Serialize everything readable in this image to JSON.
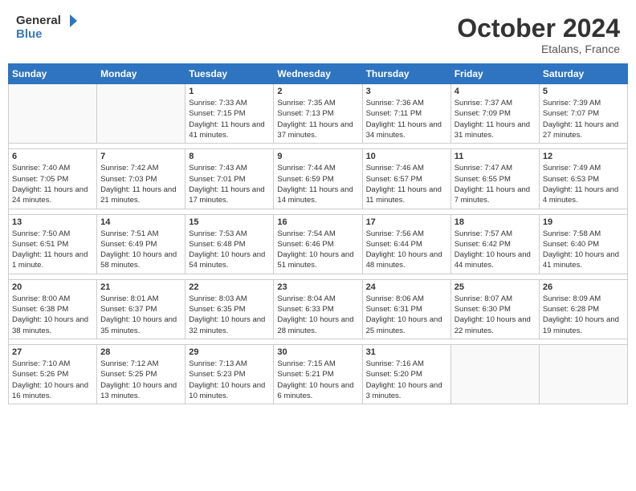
{
  "header": {
    "logo_general": "General",
    "logo_blue": "Blue",
    "month_title": "October 2024",
    "location": "Etalans, France"
  },
  "calendar": {
    "headers": [
      "Sunday",
      "Monday",
      "Tuesday",
      "Wednesday",
      "Thursday",
      "Friday",
      "Saturday"
    ],
    "weeks": [
      {
        "days": [
          {
            "number": "",
            "info": ""
          },
          {
            "number": "",
            "info": ""
          },
          {
            "number": "1",
            "info": "Sunrise: 7:33 AM\nSunset: 7:15 PM\nDaylight: 11 hours and 41 minutes."
          },
          {
            "number": "2",
            "info": "Sunrise: 7:35 AM\nSunset: 7:13 PM\nDaylight: 11 hours and 37 minutes."
          },
          {
            "number": "3",
            "info": "Sunrise: 7:36 AM\nSunset: 7:11 PM\nDaylight: 11 hours and 34 minutes."
          },
          {
            "number": "4",
            "info": "Sunrise: 7:37 AM\nSunset: 7:09 PM\nDaylight: 11 hours and 31 minutes."
          },
          {
            "number": "5",
            "info": "Sunrise: 7:39 AM\nSunset: 7:07 PM\nDaylight: 11 hours and 27 minutes."
          }
        ]
      },
      {
        "days": [
          {
            "number": "6",
            "info": "Sunrise: 7:40 AM\nSunset: 7:05 PM\nDaylight: 11 hours and 24 minutes."
          },
          {
            "number": "7",
            "info": "Sunrise: 7:42 AM\nSunset: 7:03 PM\nDaylight: 11 hours and 21 minutes."
          },
          {
            "number": "8",
            "info": "Sunrise: 7:43 AM\nSunset: 7:01 PM\nDaylight: 11 hours and 17 minutes."
          },
          {
            "number": "9",
            "info": "Sunrise: 7:44 AM\nSunset: 6:59 PM\nDaylight: 11 hours and 14 minutes."
          },
          {
            "number": "10",
            "info": "Sunrise: 7:46 AM\nSunset: 6:57 PM\nDaylight: 11 hours and 11 minutes."
          },
          {
            "number": "11",
            "info": "Sunrise: 7:47 AM\nSunset: 6:55 PM\nDaylight: 11 hours and 7 minutes."
          },
          {
            "number": "12",
            "info": "Sunrise: 7:49 AM\nSunset: 6:53 PM\nDaylight: 11 hours and 4 minutes."
          }
        ]
      },
      {
        "days": [
          {
            "number": "13",
            "info": "Sunrise: 7:50 AM\nSunset: 6:51 PM\nDaylight: 11 hours and 1 minute."
          },
          {
            "number": "14",
            "info": "Sunrise: 7:51 AM\nSunset: 6:49 PM\nDaylight: 10 hours and 58 minutes."
          },
          {
            "number": "15",
            "info": "Sunrise: 7:53 AM\nSunset: 6:48 PM\nDaylight: 10 hours and 54 minutes."
          },
          {
            "number": "16",
            "info": "Sunrise: 7:54 AM\nSunset: 6:46 PM\nDaylight: 10 hours and 51 minutes."
          },
          {
            "number": "17",
            "info": "Sunrise: 7:56 AM\nSunset: 6:44 PM\nDaylight: 10 hours and 48 minutes."
          },
          {
            "number": "18",
            "info": "Sunrise: 7:57 AM\nSunset: 6:42 PM\nDaylight: 10 hours and 44 minutes."
          },
          {
            "number": "19",
            "info": "Sunrise: 7:58 AM\nSunset: 6:40 PM\nDaylight: 10 hours and 41 minutes."
          }
        ]
      },
      {
        "days": [
          {
            "number": "20",
            "info": "Sunrise: 8:00 AM\nSunset: 6:38 PM\nDaylight: 10 hours and 38 minutes."
          },
          {
            "number": "21",
            "info": "Sunrise: 8:01 AM\nSunset: 6:37 PM\nDaylight: 10 hours and 35 minutes."
          },
          {
            "number": "22",
            "info": "Sunrise: 8:03 AM\nSunset: 6:35 PM\nDaylight: 10 hours and 32 minutes."
          },
          {
            "number": "23",
            "info": "Sunrise: 8:04 AM\nSunset: 6:33 PM\nDaylight: 10 hours and 28 minutes."
          },
          {
            "number": "24",
            "info": "Sunrise: 8:06 AM\nSunset: 6:31 PM\nDaylight: 10 hours and 25 minutes."
          },
          {
            "number": "25",
            "info": "Sunrise: 8:07 AM\nSunset: 6:30 PM\nDaylight: 10 hours and 22 minutes."
          },
          {
            "number": "26",
            "info": "Sunrise: 8:09 AM\nSunset: 6:28 PM\nDaylight: 10 hours and 19 minutes."
          }
        ]
      },
      {
        "days": [
          {
            "number": "27",
            "info": "Sunrise: 7:10 AM\nSunset: 5:26 PM\nDaylight: 10 hours and 16 minutes."
          },
          {
            "number": "28",
            "info": "Sunrise: 7:12 AM\nSunset: 5:25 PM\nDaylight: 10 hours and 13 minutes."
          },
          {
            "number": "29",
            "info": "Sunrise: 7:13 AM\nSunset: 5:23 PM\nDaylight: 10 hours and 10 minutes."
          },
          {
            "number": "30",
            "info": "Sunrise: 7:15 AM\nSunset: 5:21 PM\nDaylight: 10 hours and 6 minutes."
          },
          {
            "number": "31",
            "info": "Sunrise: 7:16 AM\nSunset: 5:20 PM\nDaylight: 10 hours and 3 minutes."
          },
          {
            "number": "",
            "info": ""
          },
          {
            "number": "",
            "info": ""
          }
        ]
      }
    ]
  }
}
